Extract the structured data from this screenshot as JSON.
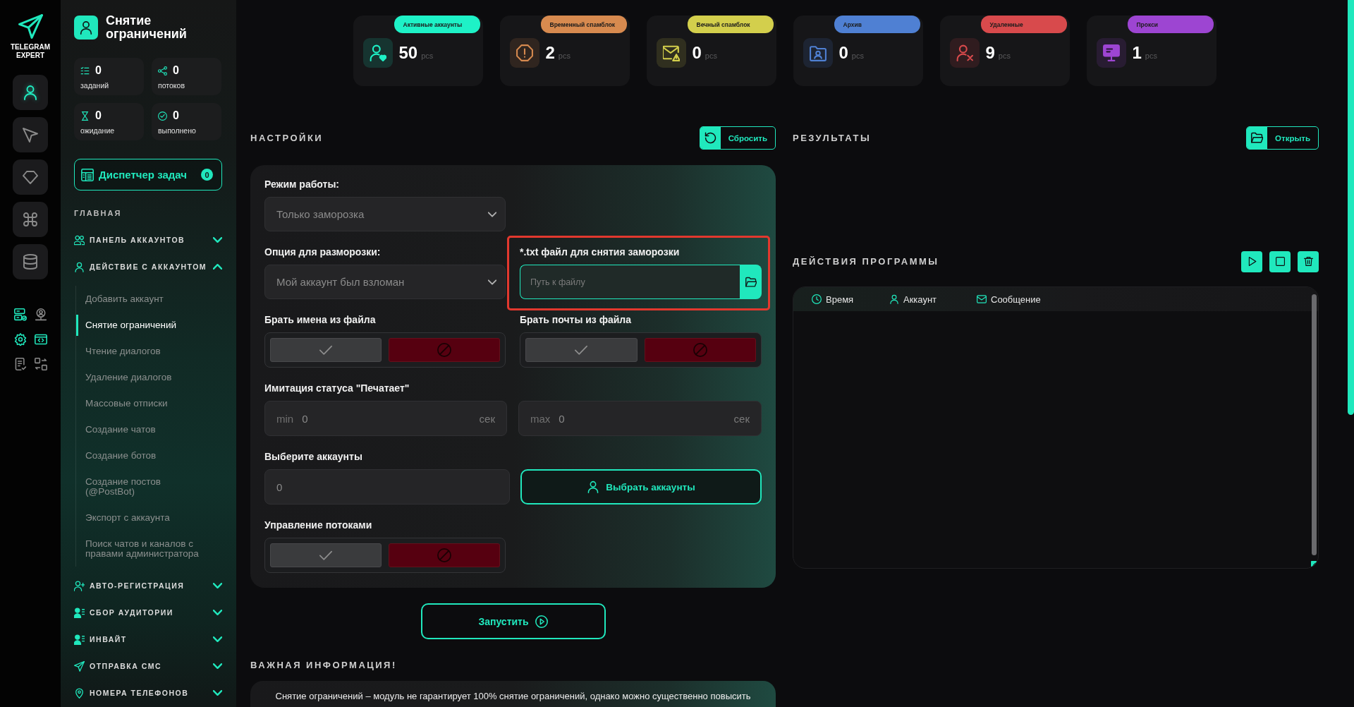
{
  "rail": {
    "logo": "TELEGRAM EXPERT",
    "items": [
      {
        "kind": "user",
        "selected": true
      },
      {
        "kind": "send",
        "selected": false
      },
      {
        "kind": "gem",
        "selected": false
      },
      {
        "kind": "command",
        "selected": false
      },
      {
        "kind": "database",
        "selected": false
      }
    ],
    "tools": [
      {
        "kind": "server",
        "active": true
      },
      {
        "kind": "user_network",
        "active": false
      },
      {
        "kind": "gear",
        "active": true
      },
      {
        "kind": "code",
        "active": true
      },
      {
        "kind": "document",
        "active": false
      },
      {
        "kind": "swap",
        "active": false
      }
    ]
  },
  "sidebar": {
    "title": "Снятие ограничений",
    "counters": [
      {
        "kind": "tasks",
        "value": "0",
        "label": "заданий"
      },
      {
        "kind": "threads",
        "value": "0",
        "label": "потоков"
      },
      {
        "kind": "waiting",
        "value": "0",
        "label": "ожидание"
      },
      {
        "kind": "done",
        "value": "0",
        "label": "выполнено"
      }
    ],
    "task_manager": {
      "label": "Диспетчер задач",
      "count": "0"
    },
    "section": "ГЛАВНАЯ",
    "menu": [
      {
        "kind": "users",
        "label": "ПАНЕЛЬ АККАУНТОВ",
        "expanded": false
      },
      {
        "kind": "user",
        "label": "ДЕЙСТВИЕ С АККАУНТОМ",
        "expanded": true,
        "children": [
          {
            "label": "Добавить аккаунт",
            "selected": false
          },
          {
            "label": "Снятие ограничений",
            "selected": true
          },
          {
            "label": "Чтение диалогов",
            "selected": false
          },
          {
            "label": "Удаление диалогов",
            "selected": false
          },
          {
            "label": "Массовые отписки",
            "selected": false
          },
          {
            "label": "Создание чатов",
            "selected": false
          },
          {
            "label": "Создание ботов",
            "selected": false
          },
          {
            "label": "Создание постов (@PostBot)",
            "selected": false
          },
          {
            "label": "Экспорт с аккаунта",
            "selected": false
          },
          {
            "label": "Поиск чатов и каналов с правами администратора",
            "selected": false
          }
        ]
      },
      {
        "kind": "user_plus",
        "label": "АВТО-РЕГИСТРАЦИЯ",
        "expanded": false
      },
      {
        "kind": "user_list",
        "label": "СБОР АУДИТОРИИ",
        "expanded": false
      },
      {
        "kind": "user_list",
        "label": "ИНВАЙТ",
        "expanded": false
      },
      {
        "kind": "send",
        "label": "ОТПРАВКА СМС",
        "expanded": false
      },
      {
        "kind": "pin",
        "label": "НОМЕРА ТЕЛЕФОНОВ",
        "expanded": false
      }
    ]
  },
  "stats_bar": [
    {
      "kind": "active",
      "label": "Активные аккаунты",
      "value": "50",
      "unit": "pcs",
      "color": "#1ef2c7"
    },
    {
      "kind": "temp_spam",
      "label": "Временный спамблок",
      "value": "2",
      "unit": "pcs",
      "color": "#d78a4f"
    },
    {
      "kind": "perm_spam",
      "label": "Вечный спамблок",
      "value": "0",
      "unit": "pcs",
      "color": "#d3cf4c"
    },
    {
      "kind": "archive",
      "label": "Архив",
      "value": "0",
      "unit": "pcs",
      "color": "#4f80d3"
    },
    {
      "kind": "deleted",
      "label": "Удаленные",
      "value": "9",
      "unit": "pcs",
      "color": "#d84a4c"
    },
    {
      "kind": "proxy",
      "label": "Прокси",
      "value": "1",
      "unit": "pcs",
      "color": "#9d45d2"
    }
  ],
  "settings": {
    "title": "НАСТРОЙКИ",
    "reset_button": "Сбросить",
    "mode": {
      "label": "Режим работы:",
      "value": "Только заморозка"
    },
    "unfreeze_option": {
      "label": "Опция для разморозки:",
      "value": "Мой аккаунт был взломан"
    },
    "unfreeze_file": {
      "label": "*.txt файл для снятия заморозки",
      "placeholder": "Путь к файлу",
      "focused": true,
      "highlighted": true
    },
    "names_from_file": {
      "label": "Брать имена из файла",
      "enabled": false
    },
    "emails_from_file": {
      "label": "Брать почты из файла",
      "enabled": false
    },
    "typing_status": {
      "label": "Имитация статуса \"Печатает\"",
      "min": {
        "prefix": "min",
        "value": "0",
        "unit": "сек"
      },
      "max": {
        "prefix": "max",
        "value": "0",
        "unit": "сек"
      }
    },
    "accounts": {
      "label": "Выберите аккаунты",
      "value": "0",
      "button": "Выбрать аккаунты"
    },
    "threads": {
      "label": "Управление потоками",
      "enabled": false
    },
    "start_button": "Запустить"
  },
  "info": {
    "title": "ВАЖНАЯ ИНФОРМАЦИЯ!",
    "text": "Снятие ограничений – модуль не гарантирует 100% снятие ограничений, однако можно существенно повысить"
  },
  "results": {
    "title": "РЕЗУЛЬТАТЫ",
    "open_button": "Открыть"
  },
  "actions": {
    "title": "ДЕЙСТВИЯ ПРОГРАММЫ",
    "buttons": [
      {
        "kind": "play"
      },
      {
        "kind": "stop"
      },
      {
        "kind": "delete"
      }
    ],
    "columns": [
      {
        "kind": "time",
        "label": "Время"
      },
      {
        "kind": "account",
        "label": "Аккаунт"
      },
      {
        "kind": "message",
        "label": "Сообщение"
      }
    ]
  }
}
